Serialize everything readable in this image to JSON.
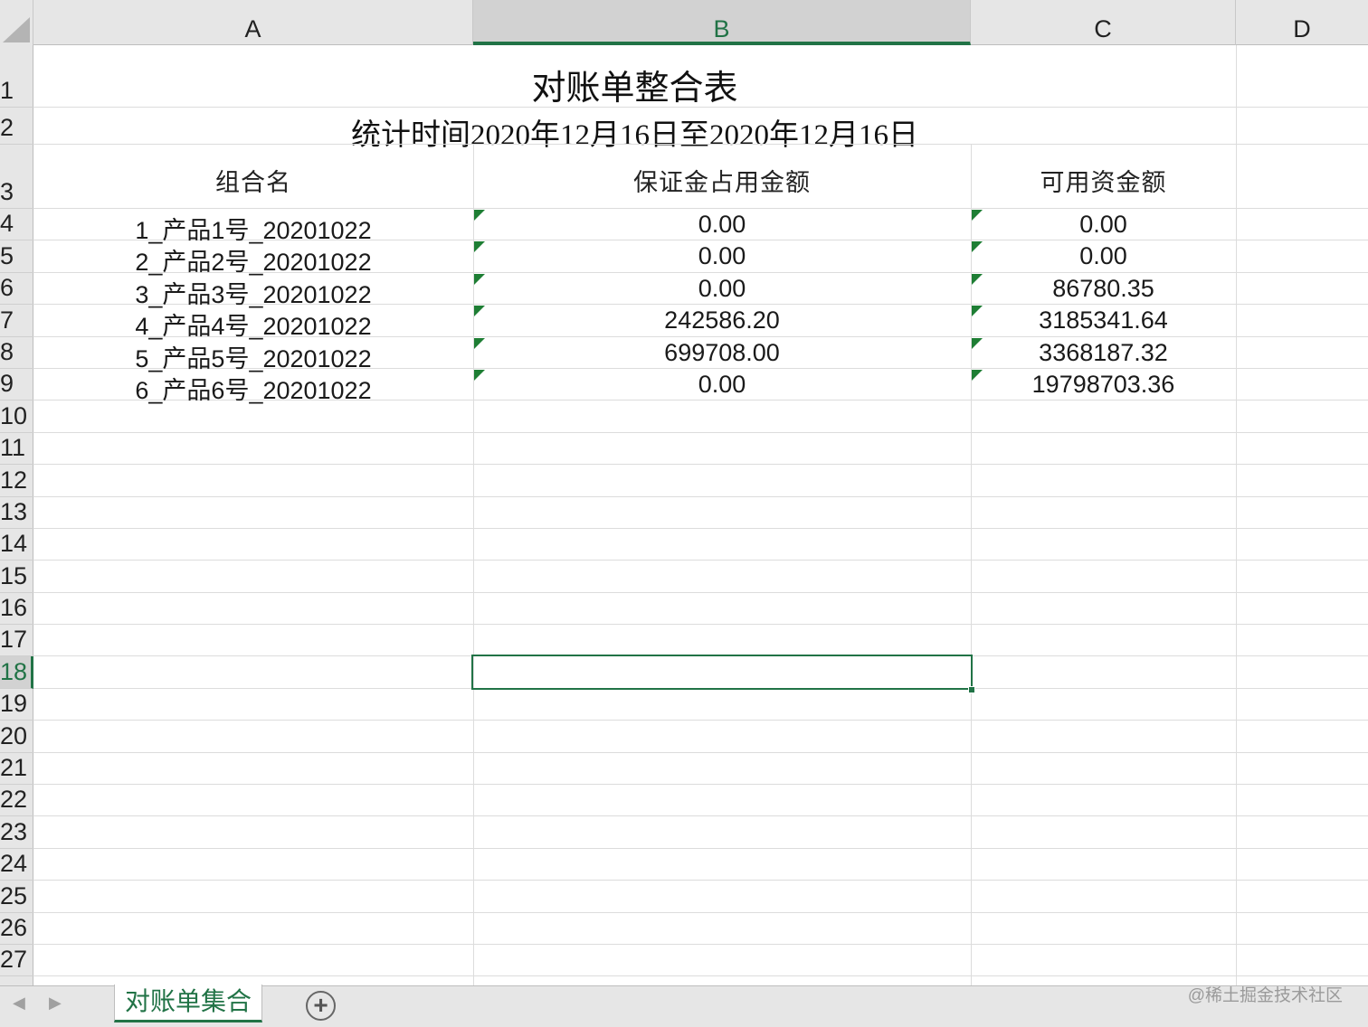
{
  "columns": [
    "A",
    "B",
    "C",
    "D"
  ],
  "rows": [
    "1",
    "2",
    "3",
    "4",
    "5",
    "6",
    "7",
    "8",
    "9",
    "10",
    "11",
    "12",
    "13",
    "14",
    "15",
    "16",
    "17",
    "18",
    "19",
    "20",
    "21",
    "22",
    "23",
    "24",
    "25",
    "26",
    "27"
  ],
  "sheet": {
    "title": "对账单整合表",
    "subtitle": "统计时间2020年12月16日至2020年12月16日",
    "headers": [
      "组合名",
      "保证金占用金额",
      "可用资金额"
    ],
    "data_rows": [
      [
        "1_产品1号_20201022",
        "0.00",
        "0.00"
      ],
      [
        "2_产品2号_20201022",
        "0.00",
        "0.00"
      ],
      [
        "3_产品3号_20201022",
        "0.00",
        "86780.35"
      ],
      [
        "4_产品4号_20201022",
        "242586.20",
        "3185341.64"
      ],
      [
        "5_产品5号_20201022",
        "699708.00",
        "3368187.32"
      ],
      [
        "6_产品6号_20201022",
        "0.00",
        "19798703.36"
      ]
    ]
  },
  "selection": {
    "column": "B",
    "row": "18"
  },
  "tabs": {
    "active": "对账单集合",
    "add_symbol": "+"
  },
  "watermark": "@稀土掘金技术社区",
  "colors": {
    "accent": "#217346",
    "error_indicator": "#1e7e34",
    "grid_line": "#dcdcdc"
  },
  "icons": [
    "tab-scroll-left-icon",
    "tab-scroll-right-icon",
    "add-sheet-icon",
    "error-indicator-icon"
  ]
}
